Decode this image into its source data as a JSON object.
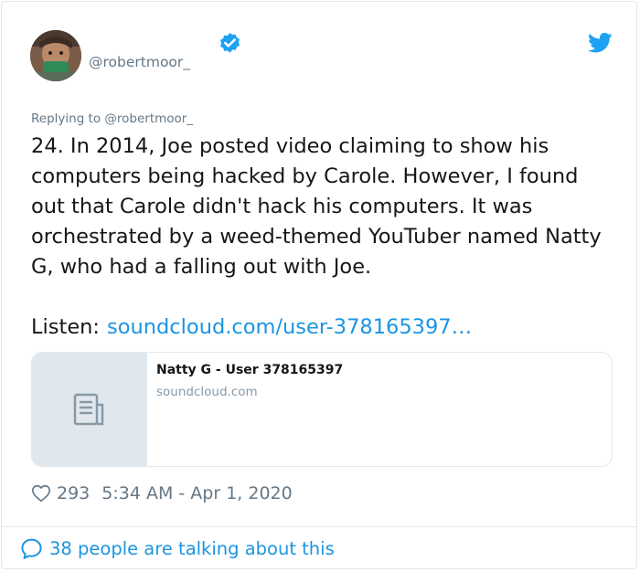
{
  "tweet": {
    "handle": "@robertmoor_",
    "replying_to": "Replying to @robertmoor_",
    "text": "24. In 2014, Joe posted video claiming to show his computers being hacked by Carole. However, I found out that Carole didn't hack his computers. It was orchestrated by a weed-themed YouTuber named Natty G, who had a falling out with Joe.",
    "listen_label": "Listen:",
    "listen_link": "soundcloud.com/user-378165397…",
    "link_card": {
      "title": "Natty G - User 378165397",
      "domain": "soundcloud.com"
    },
    "likes": "293",
    "timestamp": "5:34 AM - Apr 1, 2020",
    "talking": "38 people are talking about this"
  },
  "colors": {
    "accent": "#1b95e0",
    "secondary_text": "#657786",
    "border": "#e1e8ed"
  },
  "icons": [
    "verified-badge-icon",
    "twitter-bird-icon",
    "document-icon",
    "heart-icon",
    "speech-bubble-icon"
  ]
}
